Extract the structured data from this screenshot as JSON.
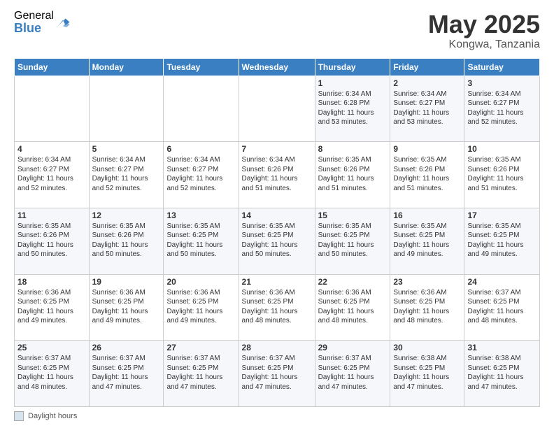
{
  "header": {
    "logo_general": "General",
    "logo_blue": "Blue",
    "month": "May 2025",
    "location": "Kongwa, Tanzania"
  },
  "footer": {
    "legend_label": "Daylight hours"
  },
  "weekdays": [
    "Sunday",
    "Monday",
    "Tuesday",
    "Wednesday",
    "Thursday",
    "Friday",
    "Saturday"
  ],
  "weeks": [
    [
      {
        "day": "",
        "info": ""
      },
      {
        "day": "",
        "info": ""
      },
      {
        "day": "",
        "info": ""
      },
      {
        "day": "",
        "info": ""
      },
      {
        "day": "1",
        "info": "Sunrise: 6:34 AM\nSunset: 6:28 PM\nDaylight: 11 hours\nand 53 minutes."
      },
      {
        "day": "2",
        "info": "Sunrise: 6:34 AM\nSunset: 6:27 PM\nDaylight: 11 hours\nand 53 minutes."
      },
      {
        "day": "3",
        "info": "Sunrise: 6:34 AM\nSunset: 6:27 PM\nDaylight: 11 hours\nand 52 minutes."
      }
    ],
    [
      {
        "day": "4",
        "info": "Sunrise: 6:34 AM\nSunset: 6:27 PM\nDaylight: 11 hours\nand 52 minutes."
      },
      {
        "day": "5",
        "info": "Sunrise: 6:34 AM\nSunset: 6:27 PM\nDaylight: 11 hours\nand 52 minutes."
      },
      {
        "day": "6",
        "info": "Sunrise: 6:34 AM\nSunset: 6:27 PM\nDaylight: 11 hours\nand 52 minutes."
      },
      {
        "day": "7",
        "info": "Sunrise: 6:34 AM\nSunset: 6:26 PM\nDaylight: 11 hours\nand 51 minutes."
      },
      {
        "day": "8",
        "info": "Sunrise: 6:35 AM\nSunset: 6:26 PM\nDaylight: 11 hours\nand 51 minutes."
      },
      {
        "day": "9",
        "info": "Sunrise: 6:35 AM\nSunset: 6:26 PM\nDaylight: 11 hours\nand 51 minutes."
      },
      {
        "day": "10",
        "info": "Sunrise: 6:35 AM\nSunset: 6:26 PM\nDaylight: 11 hours\nand 51 minutes."
      }
    ],
    [
      {
        "day": "11",
        "info": "Sunrise: 6:35 AM\nSunset: 6:26 PM\nDaylight: 11 hours\nand 50 minutes."
      },
      {
        "day": "12",
        "info": "Sunrise: 6:35 AM\nSunset: 6:26 PM\nDaylight: 11 hours\nand 50 minutes."
      },
      {
        "day": "13",
        "info": "Sunrise: 6:35 AM\nSunset: 6:25 PM\nDaylight: 11 hours\nand 50 minutes."
      },
      {
        "day": "14",
        "info": "Sunrise: 6:35 AM\nSunset: 6:25 PM\nDaylight: 11 hours\nand 50 minutes."
      },
      {
        "day": "15",
        "info": "Sunrise: 6:35 AM\nSunset: 6:25 PM\nDaylight: 11 hours\nand 50 minutes."
      },
      {
        "day": "16",
        "info": "Sunrise: 6:35 AM\nSunset: 6:25 PM\nDaylight: 11 hours\nand 49 minutes."
      },
      {
        "day": "17",
        "info": "Sunrise: 6:35 AM\nSunset: 6:25 PM\nDaylight: 11 hours\nand 49 minutes."
      }
    ],
    [
      {
        "day": "18",
        "info": "Sunrise: 6:36 AM\nSunset: 6:25 PM\nDaylight: 11 hours\nand 49 minutes."
      },
      {
        "day": "19",
        "info": "Sunrise: 6:36 AM\nSunset: 6:25 PM\nDaylight: 11 hours\nand 49 minutes."
      },
      {
        "day": "20",
        "info": "Sunrise: 6:36 AM\nSunset: 6:25 PM\nDaylight: 11 hours\nand 49 minutes."
      },
      {
        "day": "21",
        "info": "Sunrise: 6:36 AM\nSunset: 6:25 PM\nDaylight: 11 hours\nand 48 minutes."
      },
      {
        "day": "22",
        "info": "Sunrise: 6:36 AM\nSunset: 6:25 PM\nDaylight: 11 hours\nand 48 minutes."
      },
      {
        "day": "23",
        "info": "Sunrise: 6:36 AM\nSunset: 6:25 PM\nDaylight: 11 hours\nand 48 minutes."
      },
      {
        "day": "24",
        "info": "Sunrise: 6:37 AM\nSunset: 6:25 PM\nDaylight: 11 hours\nand 48 minutes."
      }
    ],
    [
      {
        "day": "25",
        "info": "Sunrise: 6:37 AM\nSunset: 6:25 PM\nDaylight: 11 hours\nand 48 minutes."
      },
      {
        "day": "26",
        "info": "Sunrise: 6:37 AM\nSunset: 6:25 PM\nDaylight: 11 hours\nand 47 minutes."
      },
      {
        "day": "27",
        "info": "Sunrise: 6:37 AM\nSunset: 6:25 PM\nDaylight: 11 hours\nand 47 minutes."
      },
      {
        "day": "28",
        "info": "Sunrise: 6:37 AM\nSunset: 6:25 PM\nDaylight: 11 hours\nand 47 minutes."
      },
      {
        "day": "29",
        "info": "Sunrise: 6:37 AM\nSunset: 6:25 PM\nDaylight: 11 hours\nand 47 minutes."
      },
      {
        "day": "30",
        "info": "Sunrise: 6:38 AM\nSunset: 6:25 PM\nDaylight: 11 hours\nand 47 minutes."
      },
      {
        "day": "31",
        "info": "Sunrise: 6:38 AM\nSunset: 6:25 PM\nDaylight: 11 hours\nand 47 minutes."
      }
    ]
  ]
}
